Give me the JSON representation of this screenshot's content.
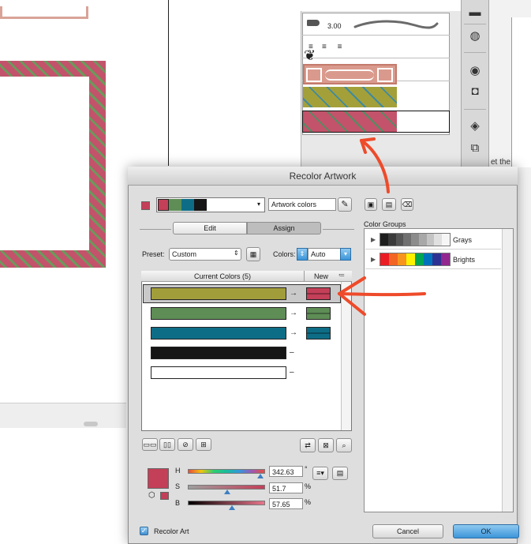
{
  "window": {
    "title": "Recolor Artwork"
  },
  "brushes_panel": {
    "brush_size": "3.00"
  },
  "dialog": {
    "artwork_colors_field": "Artwork colors",
    "tabs": [
      {
        "label": "Edit",
        "active": false
      },
      {
        "label": "Assign",
        "active": true
      }
    ],
    "preset_label": "Preset:",
    "preset_value": "Custom",
    "colors_label": "Colors:",
    "colors_value": "Auto",
    "table": {
      "current_header": "Current Colors (5)",
      "new_header": "New",
      "rows": [
        {
          "current": "#a29d3b",
          "new": "#c43f58",
          "selected": true,
          "arrow": "→"
        },
        {
          "current": "#5e8d56",
          "new": "#5e8d56",
          "selected": false,
          "arrow": "→"
        },
        {
          "current": "#0e6d86",
          "new": "#0e6d86",
          "selected": false,
          "arrow": "→"
        },
        {
          "current": "#161616",
          "new": "",
          "selected": false,
          "arrow": "–"
        },
        {
          "current": "#ffffff",
          "new": "",
          "selected": false,
          "arrow": "–"
        }
      ]
    },
    "sliders": {
      "h_label": "H",
      "h_value": "342.63",
      "h_unit": "°",
      "s_label": "S",
      "s_value": "51.7",
      "s_unit": "%",
      "b_label": "B",
      "b_value": "57.65",
      "b_unit": "%"
    },
    "active_color": "#c43f58",
    "color_groups_label": "Color Groups",
    "color_groups": [
      {
        "name": "Grays",
        "swatches": [
          "#1e1e1e",
          "#3a3a3a",
          "#555555",
          "#707070",
          "#8c8c8c",
          "#a8a8a8",
          "#c4c4c4",
          "#e0e0e0",
          "#f6f6f6"
        ]
      },
      {
        "name": "Brights",
        "swatches": [
          "#ec1c24",
          "#f26522",
          "#f7941d",
          "#fff200",
          "#00a651",
          "#0072bc",
          "#2e3192",
          "#92278f"
        ]
      }
    ],
    "recolor_art_label": "Recolor Art",
    "recolor_art_checked": true,
    "cancel_label": "Cancel",
    "ok_label": "OK"
  },
  "right_edge_text": "et the",
  "colors": {
    "pattern_rose": "#c3536b",
    "pattern_green": "#6b9a5c",
    "annotation_arrow": "#ee4b2b",
    "ok_blue": "#3c95d8"
  }
}
